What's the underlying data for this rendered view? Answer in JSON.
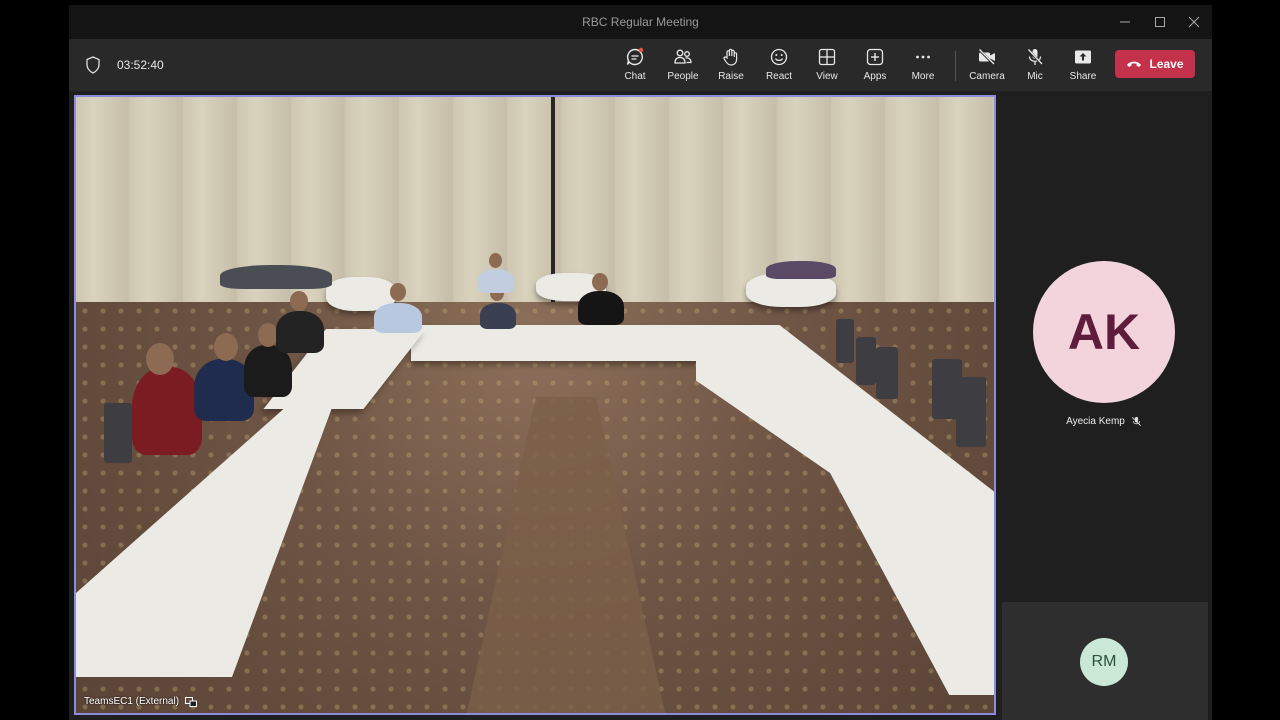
{
  "window": {
    "title": "RBC Regular Meeting"
  },
  "toolbar": {
    "timer": "03:52:40",
    "buttons": [
      {
        "id": "chat",
        "label": "Chat",
        "icon": "chat-icon"
      },
      {
        "id": "people",
        "label": "People",
        "icon": "people-icon"
      },
      {
        "id": "raise",
        "label": "Raise",
        "icon": "raise-hand-icon"
      },
      {
        "id": "react",
        "label": "React",
        "icon": "smiley-icon"
      },
      {
        "id": "view",
        "label": "View",
        "icon": "grid-icon"
      },
      {
        "id": "apps",
        "label": "Apps",
        "icon": "plus-square-icon"
      },
      {
        "id": "more",
        "label": "More",
        "icon": "ellipsis-icon"
      },
      {
        "id": "camera",
        "label": "Camera",
        "icon": "camera-off-icon"
      },
      {
        "id": "mic",
        "label": "Mic",
        "icon": "mic-off-icon"
      },
      {
        "id": "share",
        "label": "Share",
        "icon": "share-icon"
      }
    ],
    "leave_label": "Leave"
  },
  "main_video": {
    "label": "TeamsEC1 (External)"
  },
  "participants": [
    {
      "initials": "AK",
      "name": "Ayecia Kemp",
      "avatar_color": "#f3d4dc",
      "text_color": "#5e1d3b",
      "muted": true
    },
    {
      "initials": "RM",
      "avatar_color": "#c9e8d6",
      "text_color": "#2b4f3b"
    }
  ],
  "colors": {
    "leave": "#c4314b",
    "active_border": "#8b8ce0",
    "notification_dot": "#e8553c"
  }
}
